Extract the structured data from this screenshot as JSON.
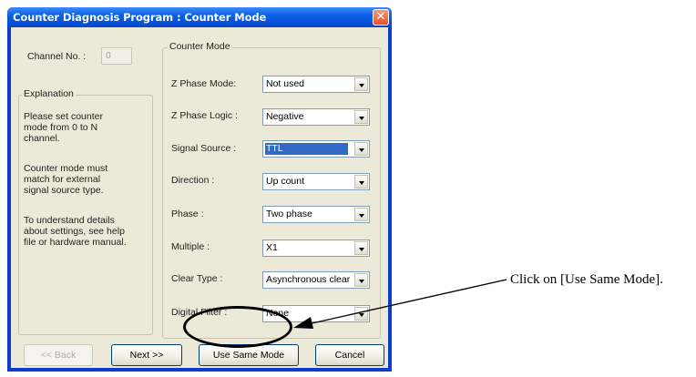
{
  "window": {
    "title": "Counter Diagnosis Program : Counter Mode",
    "close": "✕"
  },
  "channel": {
    "label": "Channel No. :",
    "value": "0"
  },
  "explanation": {
    "title": "Explanation",
    "p1": "Please set counter\nmode from 0 to N\nchannel.",
    "p2": "Counter mode must\nmatch for external\nsignal source type.",
    "p3": "To understand details\nabout settings, see help\nfile or hardware manual."
  },
  "counter_mode": {
    "title": "Counter Mode",
    "fields": [
      {
        "label": "Z Phase Mode:",
        "value": "Not used"
      },
      {
        "label": "Z Phase Logic :",
        "value": "Negative"
      },
      {
        "label": "Signal Source :",
        "value": "TTL"
      },
      {
        "label": "Direction :",
        "value": "Up count"
      },
      {
        "label": "Phase :",
        "value": "Two phase"
      },
      {
        "label": "Multiple :",
        "value": "X1"
      },
      {
        "label": "Clear Type :",
        "value": "Asynchronous clear"
      },
      {
        "label": "Digital Filter :",
        "value": "None"
      }
    ]
  },
  "buttons": {
    "back": "<< Back",
    "next": "Next >>",
    "same": "Use Same Mode",
    "cancel": "Cancel"
  },
  "annotation": {
    "text": "Click on [Use Same Mode]."
  }
}
